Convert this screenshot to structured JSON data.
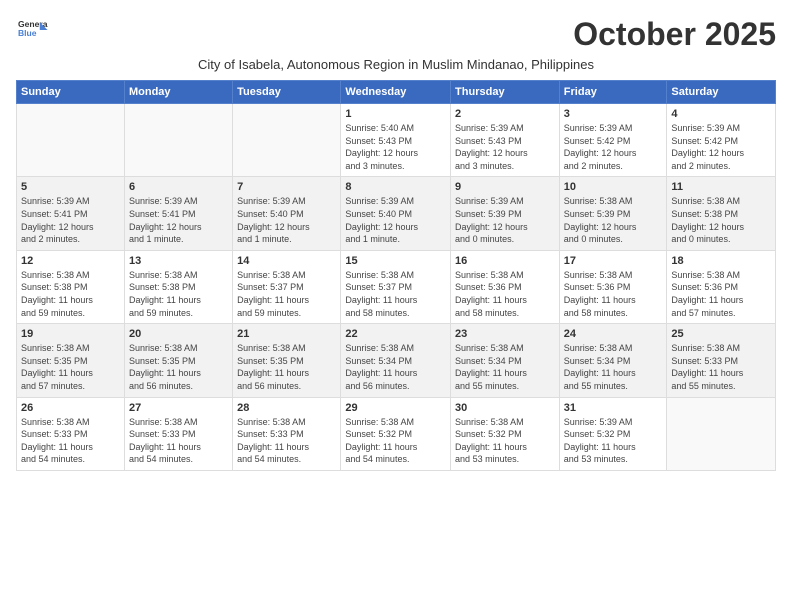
{
  "header": {
    "logo_line1": "General",
    "logo_line2": "Blue",
    "month_title": "October 2025",
    "subtitle": "City of Isabela, Autonomous Region in Muslim Mindanao, Philippines"
  },
  "days_of_week": [
    "Sunday",
    "Monday",
    "Tuesday",
    "Wednesday",
    "Thursday",
    "Friday",
    "Saturday"
  ],
  "weeks": [
    [
      {
        "day": "",
        "info": ""
      },
      {
        "day": "",
        "info": ""
      },
      {
        "day": "",
        "info": ""
      },
      {
        "day": "1",
        "info": "Sunrise: 5:40 AM\nSunset: 5:43 PM\nDaylight: 12 hours\nand 3 minutes."
      },
      {
        "day": "2",
        "info": "Sunrise: 5:39 AM\nSunset: 5:43 PM\nDaylight: 12 hours\nand 3 minutes."
      },
      {
        "day": "3",
        "info": "Sunrise: 5:39 AM\nSunset: 5:42 PM\nDaylight: 12 hours\nand 2 minutes."
      },
      {
        "day": "4",
        "info": "Sunrise: 5:39 AM\nSunset: 5:42 PM\nDaylight: 12 hours\nand 2 minutes."
      }
    ],
    [
      {
        "day": "5",
        "info": "Sunrise: 5:39 AM\nSunset: 5:41 PM\nDaylight: 12 hours\nand 2 minutes."
      },
      {
        "day": "6",
        "info": "Sunrise: 5:39 AM\nSunset: 5:41 PM\nDaylight: 12 hours\nand 1 minute."
      },
      {
        "day": "7",
        "info": "Sunrise: 5:39 AM\nSunset: 5:40 PM\nDaylight: 12 hours\nand 1 minute."
      },
      {
        "day": "8",
        "info": "Sunrise: 5:39 AM\nSunset: 5:40 PM\nDaylight: 12 hours\nand 1 minute."
      },
      {
        "day": "9",
        "info": "Sunrise: 5:39 AM\nSunset: 5:39 PM\nDaylight: 12 hours\nand 0 minutes."
      },
      {
        "day": "10",
        "info": "Sunrise: 5:38 AM\nSunset: 5:39 PM\nDaylight: 12 hours\nand 0 minutes."
      },
      {
        "day": "11",
        "info": "Sunrise: 5:38 AM\nSunset: 5:38 PM\nDaylight: 12 hours\nand 0 minutes."
      }
    ],
    [
      {
        "day": "12",
        "info": "Sunrise: 5:38 AM\nSunset: 5:38 PM\nDaylight: 11 hours\nand 59 minutes."
      },
      {
        "day": "13",
        "info": "Sunrise: 5:38 AM\nSunset: 5:38 PM\nDaylight: 11 hours\nand 59 minutes."
      },
      {
        "day": "14",
        "info": "Sunrise: 5:38 AM\nSunset: 5:37 PM\nDaylight: 11 hours\nand 59 minutes."
      },
      {
        "day": "15",
        "info": "Sunrise: 5:38 AM\nSunset: 5:37 PM\nDaylight: 11 hours\nand 58 minutes."
      },
      {
        "day": "16",
        "info": "Sunrise: 5:38 AM\nSunset: 5:36 PM\nDaylight: 11 hours\nand 58 minutes."
      },
      {
        "day": "17",
        "info": "Sunrise: 5:38 AM\nSunset: 5:36 PM\nDaylight: 11 hours\nand 58 minutes."
      },
      {
        "day": "18",
        "info": "Sunrise: 5:38 AM\nSunset: 5:36 PM\nDaylight: 11 hours\nand 57 minutes."
      }
    ],
    [
      {
        "day": "19",
        "info": "Sunrise: 5:38 AM\nSunset: 5:35 PM\nDaylight: 11 hours\nand 57 minutes."
      },
      {
        "day": "20",
        "info": "Sunrise: 5:38 AM\nSunset: 5:35 PM\nDaylight: 11 hours\nand 56 minutes."
      },
      {
        "day": "21",
        "info": "Sunrise: 5:38 AM\nSunset: 5:35 PM\nDaylight: 11 hours\nand 56 minutes."
      },
      {
        "day": "22",
        "info": "Sunrise: 5:38 AM\nSunset: 5:34 PM\nDaylight: 11 hours\nand 56 minutes."
      },
      {
        "day": "23",
        "info": "Sunrise: 5:38 AM\nSunset: 5:34 PM\nDaylight: 11 hours\nand 55 minutes."
      },
      {
        "day": "24",
        "info": "Sunrise: 5:38 AM\nSunset: 5:34 PM\nDaylight: 11 hours\nand 55 minutes."
      },
      {
        "day": "25",
        "info": "Sunrise: 5:38 AM\nSunset: 5:33 PM\nDaylight: 11 hours\nand 55 minutes."
      }
    ],
    [
      {
        "day": "26",
        "info": "Sunrise: 5:38 AM\nSunset: 5:33 PM\nDaylight: 11 hours\nand 54 minutes."
      },
      {
        "day": "27",
        "info": "Sunrise: 5:38 AM\nSunset: 5:33 PM\nDaylight: 11 hours\nand 54 minutes."
      },
      {
        "day": "28",
        "info": "Sunrise: 5:38 AM\nSunset: 5:33 PM\nDaylight: 11 hours\nand 54 minutes."
      },
      {
        "day": "29",
        "info": "Sunrise: 5:38 AM\nSunset: 5:32 PM\nDaylight: 11 hours\nand 54 minutes."
      },
      {
        "day": "30",
        "info": "Sunrise: 5:38 AM\nSunset: 5:32 PM\nDaylight: 11 hours\nand 53 minutes."
      },
      {
        "day": "31",
        "info": "Sunrise: 5:39 AM\nSunset: 5:32 PM\nDaylight: 11 hours\nand 53 minutes."
      },
      {
        "day": "",
        "info": ""
      }
    ]
  ]
}
